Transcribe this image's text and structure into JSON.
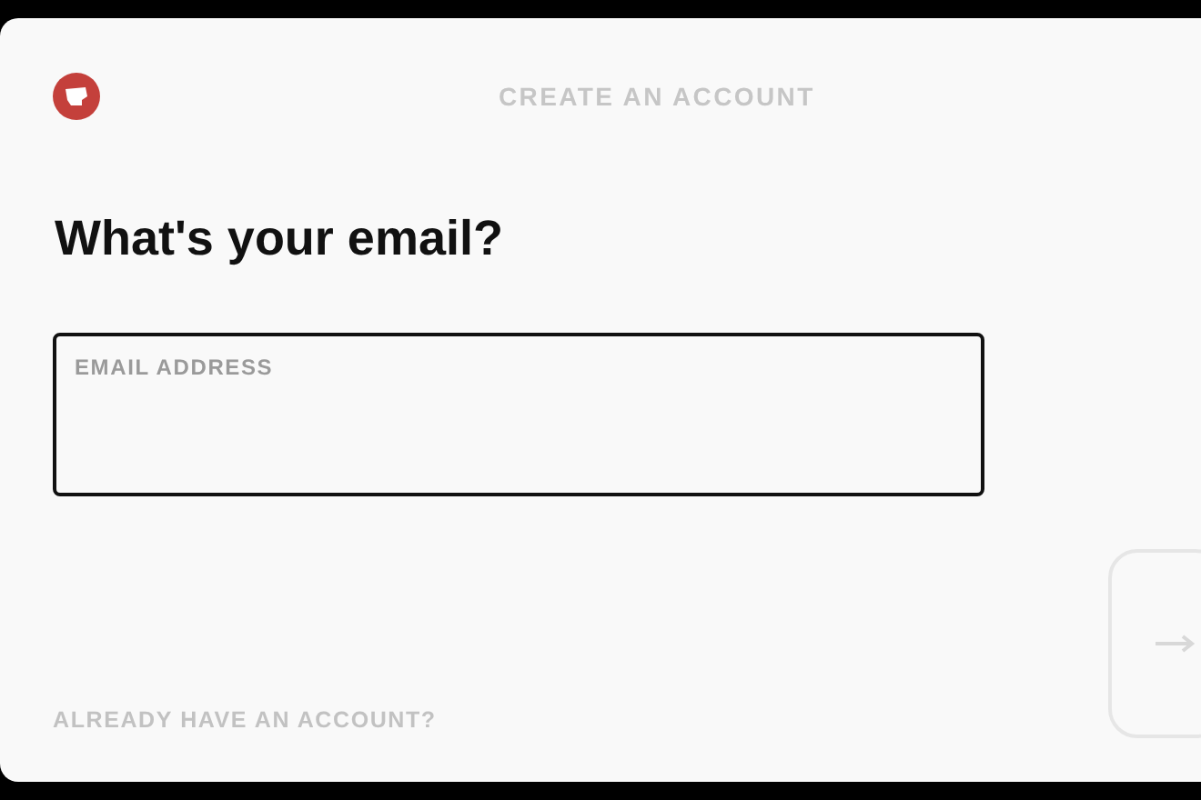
{
  "header": {
    "title": "CREATE AN ACCOUNT"
  },
  "heading": "What's your email?",
  "email_field": {
    "label": "EMAIL ADDRESS"
  },
  "footer": {
    "link": "ALREADY HAVE AN ACCOUNT?"
  }
}
